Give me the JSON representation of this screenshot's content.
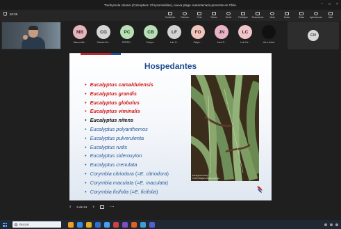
{
  "window": {
    "title": "Trachymela sloanei (Coleoptera: Chrysomelidae), nueva plaga cuarentenaria presente en Chile.",
    "controls": [
      "–",
      "□",
      "×"
    ]
  },
  "meeting": {
    "elapsed": "50:08",
    "toolbar": [
      {
        "label": "Contenido",
        "icon": "share-icon"
      },
      {
        "label": "Cámara",
        "icon": "camera-icon"
      },
      {
        "label": "Chat",
        "icon": "chat-icon"
      },
      {
        "label": "Reacc",
        "icon": "reaction-icon"
      },
      {
        "label": "Gente",
        "icon": "people-icon"
      },
      {
        "label": "Participar",
        "icon": "raise-hand-icon"
      },
      {
        "label": "Reacciones",
        "icon": "emoji-icon"
      },
      {
        "label": "Vista",
        "icon": "view-icon"
      },
      {
        "label": "Notas",
        "icon": "notes-icon"
      },
      {
        "label": "Salas",
        "icon": "rooms-icon"
      },
      {
        "label": "Aplicaciones",
        "icon": "apps-icon"
      },
      {
        "label": "Más",
        "icon": "more-icon"
      }
    ],
    "participants": [
      {
        "initials": "MB",
        "name": "Marcos Be...",
        "color": "#e8b4b8"
      },
      {
        "initials": "CG",
        "name": "Claudio Go...",
        "color": "#d6d6d6"
      },
      {
        "initials": "PC",
        "name": "PATRIC...",
        "color": "#b9e0b4"
      },
      {
        "initials": "CB",
        "name": "Evelyn...",
        "color": "#b6dfb4"
      },
      {
        "initials": "LF",
        "name": "Luis G...",
        "color": "#d4d4d4"
      },
      {
        "initials": "FO",
        "name": "Felipe ...",
        "color": "#f2c4bc"
      },
      {
        "initials": "JN",
        "name": "José S...",
        "color": "#e8b4c4"
      },
      {
        "initials": "LC",
        "name": "Luis Ca...",
        "color": "#f0c4c8"
      },
      {
        "initials": "",
        "name": "Ver a todos",
        "color": "#111111"
      }
    ],
    "spotlight_initials": "CH"
  },
  "slide": {
    "title": "Hospedantes",
    "species": [
      {
        "text": "Eucalyptus camaldulensis",
        "style": "red"
      },
      {
        "text": "Eucalyptus grandis",
        "style": "red"
      },
      {
        "text": "Eucalyptus globulus",
        "style": "red"
      },
      {
        "text": "Eucalyptus viminalis",
        "style": "red"
      },
      {
        "text": "Eucalyptus nitens",
        "style": "black"
      },
      {
        "text": "Eucalyptus polyanthemos",
        "style": "blue"
      },
      {
        "text": "Eucalyptus pulverulenta",
        "style": "blue"
      },
      {
        "text": "Eucalyptus rudis",
        "style": "blue"
      },
      {
        "text": "Eucalyptus sideroxylon",
        "style": "blue"
      },
      {
        "text": "Eucalyptus crenulata",
        "style": "blue"
      },
      {
        "text": "Corymbia citriodora",
        "suffix_open": " (=",
        "alt": "E. citriodora",
        "suffix_close": ")",
        "style": "blue"
      },
      {
        "text": "Corymbia maculata",
        "suffix_open": " (=",
        "alt": "E. maculata",
        "suffix_close": ")",
        "style": "blue"
      },
      {
        "text": "Corymbia ficifolia",
        "suffix_open": " (=",
        "alt": "E. ficifolia",
        "suffix_close": ")",
        "style": "blue"
      }
    ],
    "photo_caption_1": "Eucalyptus Lisseyi",
    "photo_caption_2": "© 2013 Rogers, Daniel Laciano",
    "brand_colors": {
      "red": "#c0272d",
      "blue": "#1f4e9a"
    }
  },
  "navigation": {
    "page": "6 de 51"
  },
  "taskbar": {
    "search_placeholder": "Buscar",
    "app_colors": [
      "#f0a020",
      "#3c8ae0",
      "#e0b020",
      "#2f70d0",
      "#48a0e8",
      "#d04040",
      "#7a50c0",
      "#e06020",
      "#3aa0d0",
      "#5060d0"
    ]
  }
}
